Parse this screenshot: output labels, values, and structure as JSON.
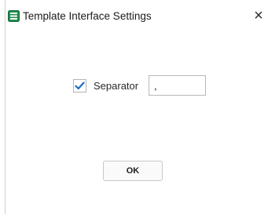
{
  "window": {
    "title": "Template Interface Settings",
    "close_glyph": "×",
    "app_icon": "template-app-icon",
    "accent_color": "#1f8b4c"
  },
  "form": {
    "separator_checkbox_checked": true,
    "separator_label": "Separator",
    "separator_value": ","
  },
  "buttons": {
    "ok_label": "OK"
  }
}
